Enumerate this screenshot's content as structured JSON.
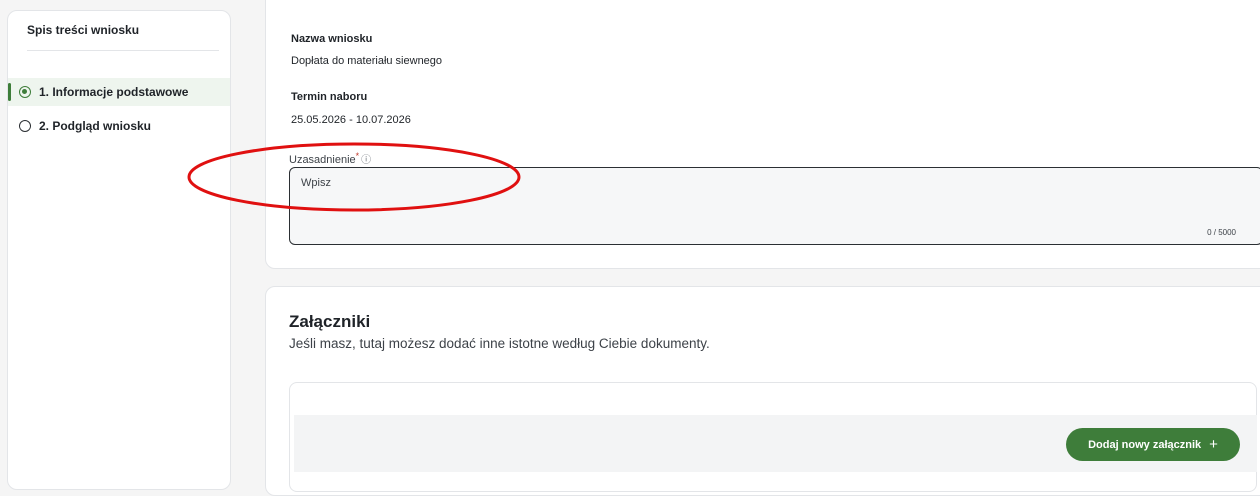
{
  "sidebar": {
    "title": "Spis treści wniosku",
    "items": [
      {
        "label": "1. Informacje podstawowe",
        "active": true
      },
      {
        "label": "2. Podgląd wniosku",
        "active": false
      }
    ]
  },
  "details": {
    "name_label": "Nazwa wniosku",
    "name_value": "Dopłata do materiału siewnego",
    "term_label": "Termin naboru",
    "term_value": "25.05.2026 - 10.07.2026"
  },
  "justification": {
    "label": "Uzasadnienie",
    "required_mark": "*",
    "info_icon": "info-icon",
    "placeholder": "Wpisz",
    "counter": "0 / 5000"
  },
  "attachments": {
    "title": "Załączniki",
    "subtitle": "Jeśli masz, tutaj możesz dodać inne istotne według Ciebie dokumenty.",
    "add_button_label": "Dodaj nowy załącznik",
    "add_button_icon": "plus-icon"
  },
  "colors": {
    "accent_green": "#3e7d3a",
    "annotation_red": "#e01010"
  }
}
